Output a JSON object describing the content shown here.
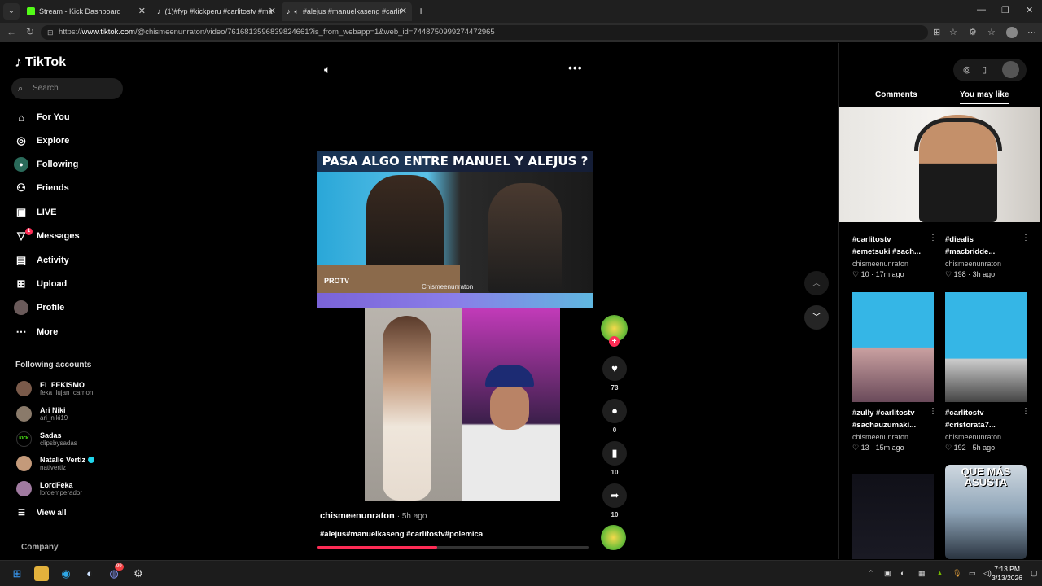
{
  "browser": {
    "tabs": [
      {
        "title": "Stream - Kick Dashboard",
        "favicon_color": "#53fc18"
      },
      {
        "title": "(1)#fyp #kickperu #carlitostv #ma",
        "favicon_color": "#ffffff"
      },
      {
        "title": "#alejus #manuelkaseng #carlit",
        "favicon_color": "#ffffff",
        "active": true
      }
    ],
    "new_tab": "+",
    "url_prefix": "https://",
    "url_domain": "www.tiktok.com",
    "url_path": "/@chismeenunraton/video/7616813596839824661?is_from_webapp=1&web_id=7448750999274472965"
  },
  "tiktok": {
    "brand": "TikTok",
    "search_placeholder": "Search",
    "menu": [
      {
        "label": "For You",
        "icon": "home-icon"
      },
      {
        "label": "Explore",
        "icon": "compass-icon"
      },
      {
        "label": "Following",
        "icon": "following-icon"
      },
      {
        "label": "Friends",
        "icon": "friends-icon"
      },
      {
        "label": "LIVE",
        "icon": "live-icon"
      },
      {
        "label": "Messages",
        "icon": "messages-icon",
        "badge": "1"
      },
      {
        "label": "Activity",
        "icon": "activity-icon"
      },
      {
        "label": "Upload",
        "icon": "upload-icon"
      },
      {
        "label": "Profile",
        "icon": "profile-icon"
      },
      {
        "label": "More",
        "icon": "more-icon"
      }
    ],
    "following_title": "Following accounts",
    "following": [
      {
        "name": "EL FEKISMO",
        "handle": "feka_lujan_carrion",
        "color": "#7a5a4a"
      },
      {
        "name": "Ari Niki",
        "handle": "ari_niki19",
        "color": "#8a7a6a"
      },
      {
        "name": "Sadas",
        "handle": "clipsbysadas",
        "color": "#000000"
      },
      {
        "name": "Natalie Vertiz",
        "handle": "nativertiz",
        "color": "#c49a7a",
        "verified": true
      },
      {
        "name": "LordFeka",
        "handle": "lordemperador_",
        "color": "#a07aa0"
      }
    ],
    "view_all": "View all",
    "company": "Company"
  },
  "video": {
    "banner": "PASA ALGO ENTRE MANUEL Y ALEJUS ?",
    "protv": "PROTV",
    "credit": "Chismeenunraton",
    "likes": "73",
    "comments": "0",
    "saves": "10",
    "shares": "10",
    "author": "chismeenunraton",
    "time": "· 5h ago",
    "hashtags": "#alejus#manuelkaseng #carlitostv#polemica",
    "progress": 0.44
  },
  "right_panel": {
    "tab_comments": "Comments",
    "tab_you_may_like": "You may like",
    "cards": [
      {
        "title1": "#carlitostv",
        "title2": "#emetsuki #sach...",
        "user": "chismeenunraton",
        "likes": "10",
        "time": "17m ago"
      },
      {
        "title1": "#diealis",
        "title2": "#macbridde...",
        "user": "chismeenunraton",
        "likes": "198",
        "time": "3h ago"
      },
      {
        "title1": "#zully #carlitostv",
        "title2": "#sachauzumaki...",
        "user": "chismeenunraton",
        "likes": "13",
        "time": "15m ago"
      },
      {
        "title1": "#carlitostv",
        "title2": "#cristorata7...",
        "user": "chismeenunraton",
        "likes": "192",
        "time": "5h ago"
      }
    ],
    "thumb_text": "QUE MÁS ASUSTA"
  },
  "taskbar": {
    "time": "7:13 PM",
    "date": "3/13/2026",
    "discord_badge": "99"
  }
}
